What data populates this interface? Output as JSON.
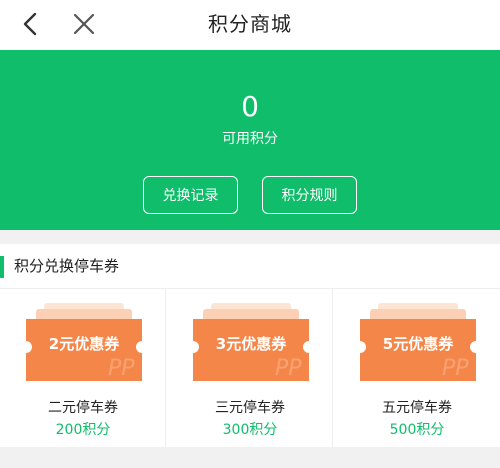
{
  "header": {
    "title": "积分商城",
    "back_icon": "chevron-left-icon",
    "close_icon": "close-icon"
  },
  "points": {
    "value": "0",
    "label": "可用积分",
    "history_label": "兑换记录",
    "rules_label": "积分规则"
  },
  "section": {
    "title": "积分兑换停车券"
  },
  "coupons": [
    {
      "badge": "2元优惠券",
      "name": "二元停车券",
      "price": "200积分"
    },
    {
      "badge": "3元优惠券",
      "name": "三元停车券",
      "price": "300积分"
    },
    {
      "badge": "5元优惠券",
      "name": "五元停车券",
      "price": "500积分"
    }
  ],
  "colors": {
    "brand_green": "#10bd6a",
    "coupon_orange": "#f5864a",
    "coupon_back": "#fbd8c1"
  }
}
